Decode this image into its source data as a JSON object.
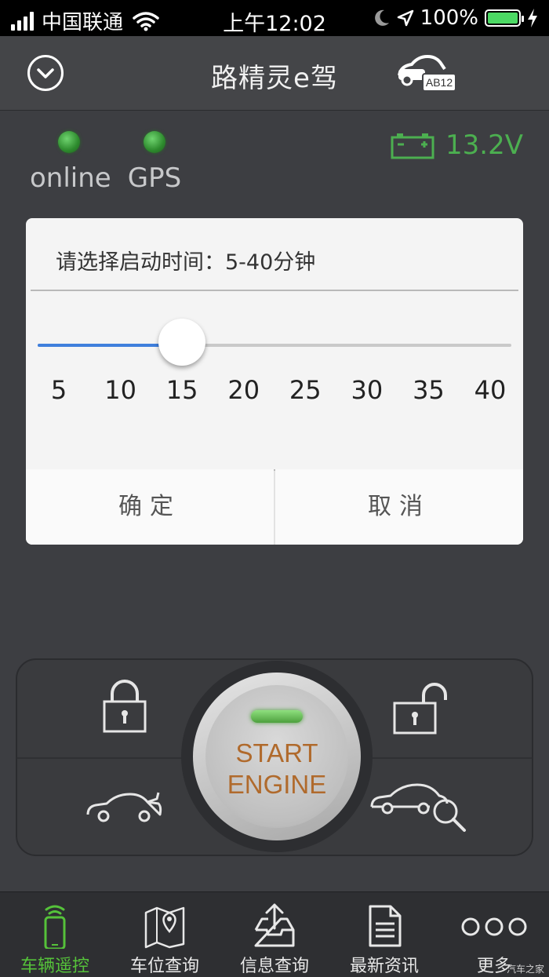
{
  "status_bar": {
    "carrier": "中国联通",
    "time": "上午12:02",
    "battery_percent": "100%"
  },
  "nav": {
    "title": "路精灵e驾",
    "plate_badge": "AB12"
  },
  "indicators": {
    "online_label": "online",
    "gps_label": "GPS",
    "voltage": "13.2V"
  },
  "dialog": {
    "title": "请选择启动时间：5-40分钟",
    "slider": {
      "min": 5,
      "max": 40,
      "value": 15
    },
    "ticks": [
      "5",
      "10",
      "15",
      "20",
      "25",
      "30",
      "35",
      "40"
    ],
    "confirm_label": "确定",
    "cancel_label": "取消"
  },
  "control_panel": {
    "start_line1": "START",
    "start_line2": "ENGINE"
  },
  "tabs": [
    {
      "label": "车辆遥控",
      "icon": "phone-signal-icon",
      "active": true
    },
    {
      "label": "车位查询",
      "icon": "map-pin-icon",
      "active": false
    },
    {
      "label": "信息查询",
      "icon": "inbox-upload-icon",
      "active": false
    },
    {
      "label": "最新资讯",
      "icon": "document-icon",
      "active": false
    },
    {
      "label": "更多",
      "icon": "more-dots-icon",
      "active": false
    }
  ],
  "watermark": "汽车之家",
  "colors": {
    "accent_green": "#55c23a",
    "slider_blue": "#3f7fdc",
    "start_text": "#b06a2c"
  }
}
